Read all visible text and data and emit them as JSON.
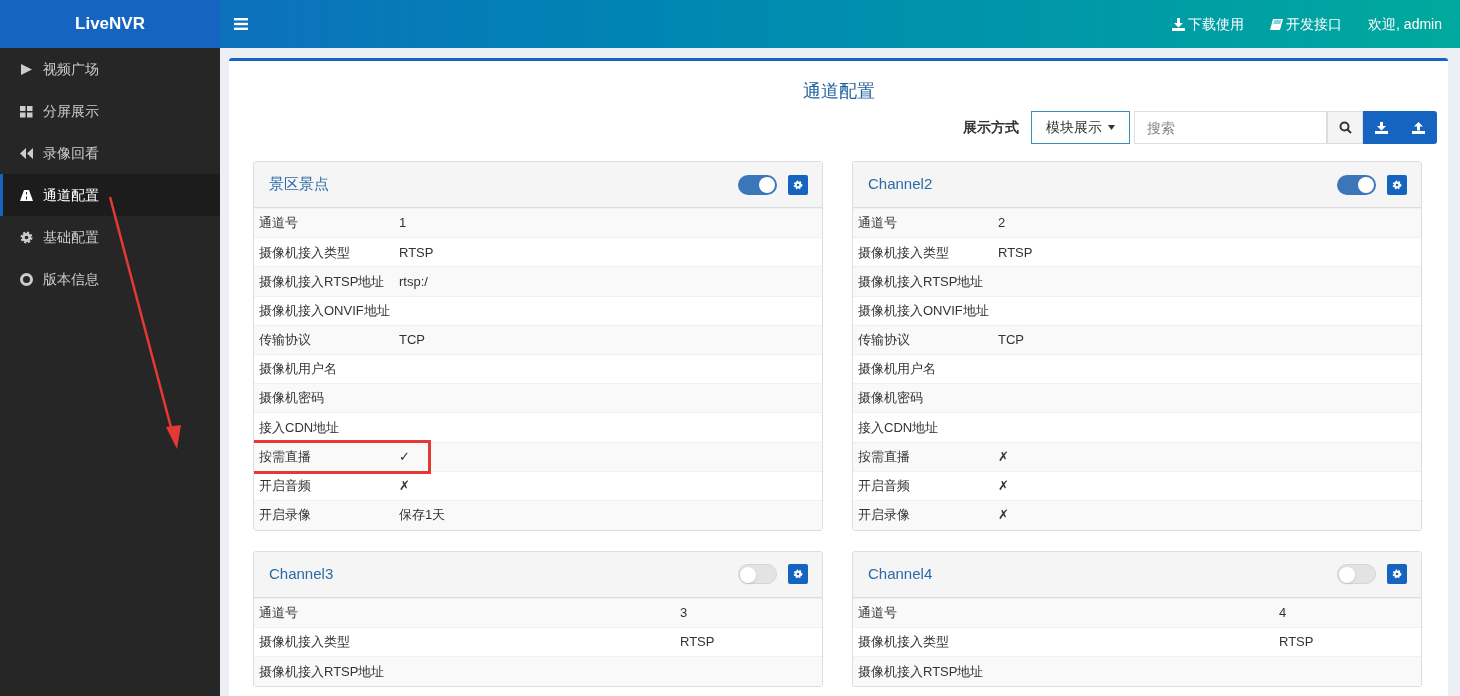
{
  "brand": "LiveNVR",
  "header_links": [
    {
      "kind": "download",
      "label": "下载使用"
    },
    {
      "kind": "book",
      "label": "开发接口"
    },
    {
      "kind": "plain",
      "label": "欢迎, admin"
    }
  ],
  "sidebar": {
    "items": [
      {
        "kind": "play",
        "label": "视频广场",
        "selected": false
      },
      {
        "kind": "grid",
        "label": "分屏展示",
        "selected": false
      },
      {
        "kind": "backward",
        "label": "录像回看",
        "selected": false
      },
      {
        "kind": "road",
        "label": "通道配置",
        "selected": true
      },
      {
        "kind": "gear",
        "label": "基础配置",
        "selected": false
      },
      {
        "kind": "lifering",
        "label": "版本信息",
        "selected": false
      }
    ]
  },
  "page_title": "通道配置",
  "toolbar": {
    "display_label": "展示方式",
    "display_select": "模块展示",
    "search": {
      "placeholder": "搜索"
    }
  },
  "channels": [
    {
      "name": "景区景点",
      "enabled": true,
      "rows": [
        {
          "label": "通道号",
          "value": "1"
        },
        {
          "label": "摄像机接入类型",
          "value": "RTSP"
        },
        {
          "label": "摄像机接入RTSP地址",
          "value": "rtsp:/"
        },
        {
          "label": "摄像机接入ONVIF地址"
        },
        {
          "label": "传输协议",
          "value": "TCP"
        },
        {
          "label": "摄像机用户名"
        },
        {
          "label": "摄像机密码"
        },
        {
          "label": "接入CDN地址"
        },
        {
          "label": "按需直播",
          "value": "✓",
          "highlighted": true
        },
        {
          "label": "开启音频",
          "value": "✗"
        },
        {
          "label": "开启录像",
          "value": "保存1天"
        }
      ]
    },
    {
      "name": "Channel2",
      "enabled": true,
      "rows": [
        {
          "label": "通道号",
          "value": "2"
        },
        {
          "label": "摄像机接入类型",
          "value": "RTSP"
        },
        {
          "label": "摄像机接入RTSP地址"
        },
        {
          "label": "摄像机接入ONVIF地址"
        },
        {
          "label": "传输协议",
          "value": "TCP"
        },
        {
          "label": "摄像机用户名"
        },
        {
          "label": "摄像机密码"
        },
        {
          "label": "接入CDN地址"
        },
        {
          "label": "按需直播",
          "value": "✗"
        },
        {
          "label": "开启音频",
          "value": "✗"
        },
        {
          "label": "开启录像",
          "value": "✗"
        }
      ]
    },
    {
      "name": "Channel3",
      "enabled": false,
      "rows": [
        {
          "label": "通道号",
          "value": "3"
        },
        {
          "label": "摄像机接入类型",
          "value": "RTSP"
        },
        {
          "label": "摄像机接入RTSP地址"
        }
      ]
    },
    {
      "name": "Channel4",
      "enabled": false,
      "rows": [
        {
          "label": "通道号",
          "value": "4"
        },
        {
          "label": "摄像机接入类型",
          "value": "RTSP"
        },
        {
          "label": "摄像机接入RTSP地址"
        }
      ]
    }
  ]
}
